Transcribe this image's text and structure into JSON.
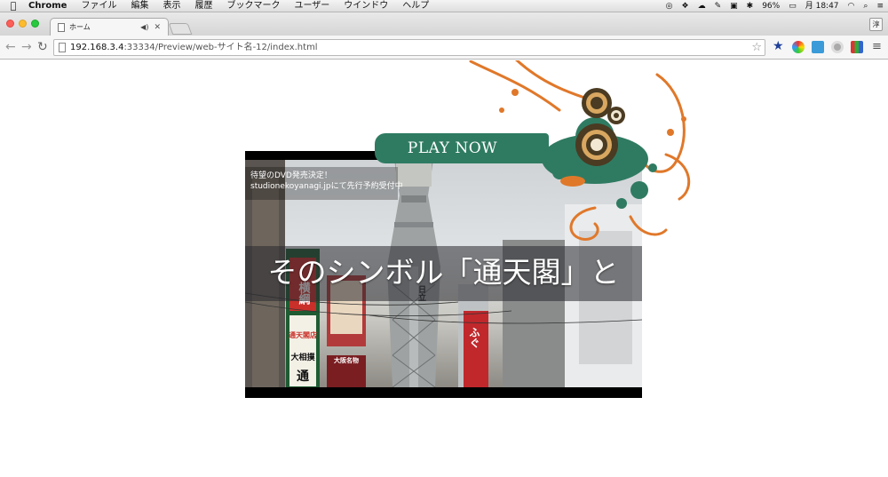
{
  "menubar": {
    "app_name": "Chrome",
    "menus": [
      "ファイル",
      "編集",
      "表示",
      "履歴",
      "ブックマーク",
      "ユーザー",
      "ウインドウ",
      "ヘルプ"
    ],
    "battery": "96%",
    "clock": "月 18:47"
  },
  "browser": {
    "tab_title": "ホーム",
    "profile_label": "淳",
    "url_host": "192.168.3.4",
    "url_rest": ":33334/Preview/web-サイト名-12/index.html"
  },
  "page": {
    "play_now": "PLAY NOW",
    "video": {
      "notice_line1": "待望のDVD発売決定！",
      "notice_line2": "studionekoyanagi.jpにて先行予約受付中",
      "subtitle": "そのシンボル「通天閣」と",
      "signs": [
        "横綱",
        "通天閣店",
        "大相撲",
        "通",
        "大阪名物",
        "日立",
        "ふぐ"
      ]
    }
  },
  "colors": {
    "accent_green": "#2f7b62",
    "accent_orange": "#e0782a",
    "deco_brown": "#4a3b22"
  }
}
